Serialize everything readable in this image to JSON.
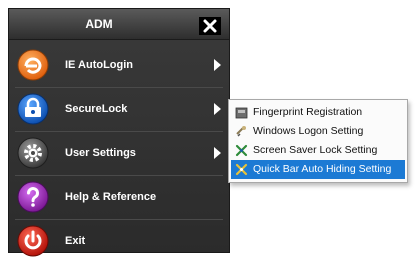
{
  "window": {
    "title": "ADM"
  },
  "menu": {
    "items": [
      {
        "label": "IE AutoLogin",
        "icon": "globe-icon",
        "color": "#f07a22",
        "has_submenu": true
      },
      {
        "label": "SecureLock",
        "icon": "lock-icon",
        "color": "#1b6fd1",
        "has_submenu": true
      },
      {
        "label": "User Settings",
        "icon": "gear-icon",
        "color": "#5b5b5b",
        "has_submenu": true
      },
      {
        "label": "Help & Reference",
        "icon": "help-icon",
        "color": "#9b2fb3",
        "has_submenu": false
      },
      {
        "label": "Exit",
        "icon": "power-icon",
        "color": "#d8231a",
        "has_submenu": false
      }
    ]
  },
  "submenu": {
    "items": [
      {
        "label": "Fingerprint Registration",
        "icon": "fingerprint-reader-icon"
      },
      {
        "label": "Windows Logon Setting",
        "icon": "windows-logon-icon"
      },
      {
        "label": "Screen Saver Lock Setting",
        "icon": "screen-saver-lock-icon"
      },
      {
        "label": "Quick Bar Auto Hiding Setting",
        "icon": "quick-bar-icon",
        "selected": true
      }
    ],
    "selection_color": "#1c7ad4"
  }
}
